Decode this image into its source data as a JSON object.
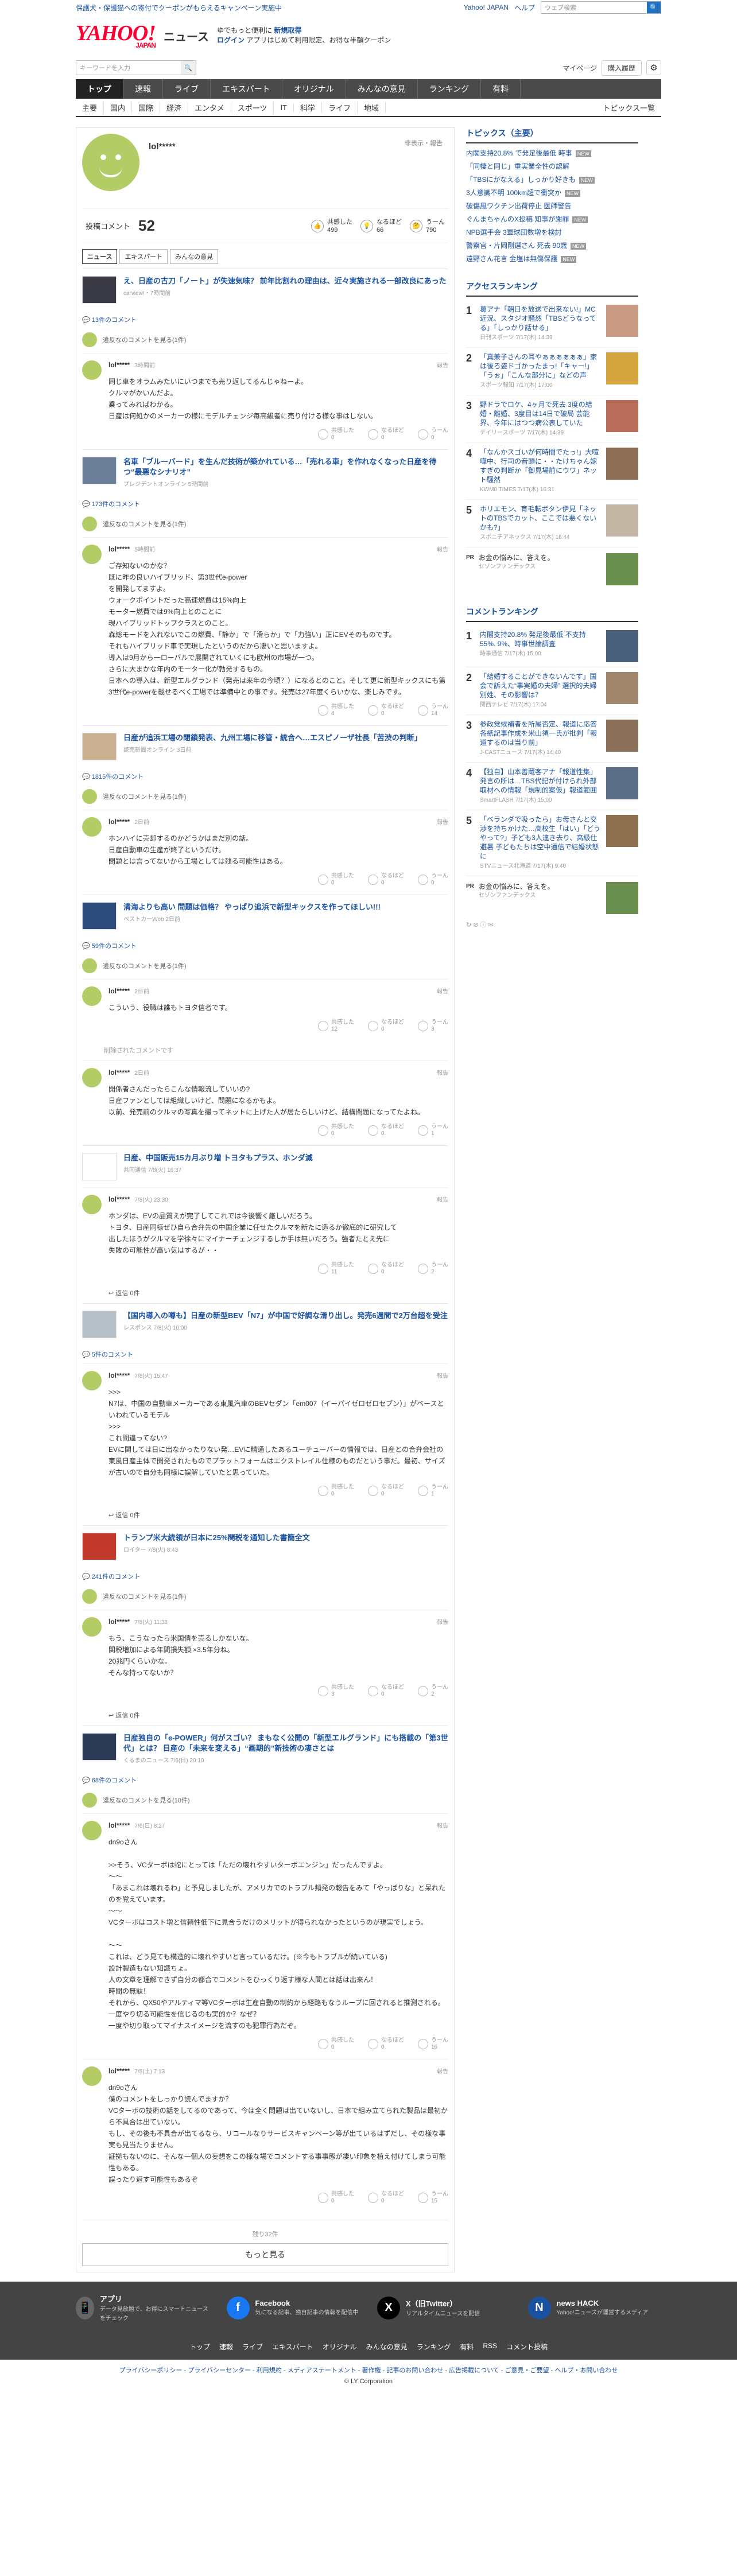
{
  "topbar": {
    "left": "保護犬・保護猫への寄付でクーポンがもらえるキャンペーン実施中",
    "links": [
      "Yahoo! JAPAN",
      "ヘルプ"
    ],
    "search_placeholder": "ウェブ検索",
    "search_btn": "🔍"
  },
  "header": {
    "logo": "YAHOO!",
    "logo_sub": "JAPAN",
    "service": "ニュース",
    "promo1": "ゆでもっと便利に",
    "promo1b": "新規取得",
    "promo2": "ログイン",
    "promo2b": "アプリはじめて利用限定、お得な半額クーポン"
  },
  "searchrow": {
    "placeholder": "キーワードを入力",
    "btn": "🔍",
    "mypage": "マイページ",
    "purchase": "購入履歴",
    "gear": "⚙"
  },
  "nav": [
    "トップ",
    "速報",
    "ライブ",
    "エキスパート",
    "オリジナル",
    "みんなの意見",
    "ランキング",
    "有料"
  ],
  "subnav": [
    "主要",
    "国内",
    "国際",
    "経済",
    "エンタメ",
    "スポーツ",
    "IT",
    "科学",
    "ライフ",
    "地域"
  ],
  "subnav_right": "トピックス一覧",
  "profile": {
    "name": "lol*****",
    "report": "非表示・報告",
    "label": "投稿コメント",
    "count": "52",
    "stats": [
      {
        "icon": "👍",
        "label": "共感した",
        "value": "499"
      },
      {
        "icon": "💡",
        "label": "なるほど",
        "value": "66"
      },
      {
        "icon": "🤔",
        "label": "うーん",
        "value": "790"
      }
    ]
  },
  "tabs": [
    "ニュース",
    "エキスパート",
    "みんなの意見"
  ],
  "vote_labels": [
    "共感した",
    "なるほど",
    "うーん"
  ],
  "reply_label": "返信",
  "reply_prompt": "違反なのコメントを見る(1件)",
  "deleted": "削除されたコメントです",
  "articles": [
    {
      "title": "え、日産の古刀「ノート」が失速気味？ 前年比割れの理由は、近々実施される一部改良にあった",
      "src": "carview!・7時間前",
      "count": "13件のコメント",
      "prompt": "違反なのコメントを見る(1件)",
      "color": "#3a3a44",
      "comments": [
        {
          "name": "lol*****",
          "time": "3時間前",
          "text": "同じ車をオラムみたいにいつまでも売り返してるんじゃねーよ。\nクルマがかいんだよ。\n乗ってみればわかる。\n日産は何処かのメーカーの様にモデルチェンジ毎高級者に売り付ける様な事はしない。",
          "votes": [
            "0",
            "0",
            "0"
          ]
        }
      ]
    },
    {
      "title": "名車「ブルーバード」を生んだ技術が築かれている…「売れる車」を作れなくなった日産を待つ“最悪なシナリオ”",
      "src": "プレジデントオンライン 5時間前",
      "count": "173件のコメント",
      "prompt": "違反なのコメントを見る(1件)",
      "color": "#6b7f99",
      "comments": [
        {
          "name": "lol*****",
          "time": "5時間前",
          "text": "ご存知ないのかな？\n既に昨の良いハイブリッド、第3世代e-power\nを開発してますよ。\nウォークポイントだった高速燃費は15%向上\nモーター燃費では9%向上とのことに\n現ハイブリッドトップクラスとのこと。\n森総モードを入れないでこの燃費、「静か」で「滑らか」で「力強い」正にEVそのものです。\nそれもハイブリッド車で実現したというのだから凄いと思いますよ。\n導入は9月から一ローバルで展開されていくにも欧州の市場が一つ。\nさらに大まかな年内のモーター化が勃発するもの。\n日本への導入は、新型エルグランド（発売は来年の今頃？）になるとのこと。そして更に新型キックスにも第3世代e-powerを載せるべく工場では準備中との事です。発売は27年度くらいかな、楽しみです。",
          "votes": [
            "4",
            "0",
            "14"
          ]
        }
      ]
    },
    {
      "title": "日産が追浜工場の閉鎖発表、九州工場に移管・統合へ…エスピノーザ社長「苦渋の判断」",
      "src": "読売新聞オンライン 3日前",
      "count": "1815件のコメント",
      "prompt": "違反なのコメントを見る(1件)",
      "color": "#c8b090",
      "comments": [
        {
          "name": "lol*****",
          "time": "2日前",
          "text": "ホンハイに売却するのかどうかはまだ別の話。\n日産自動車の生産が終了というだけ。\n問題とは言ってないから工場としては残る可能性はある。",
          "votes": [
            "0",
            "0",
            "0"
          ]
        }
      ]
    },
    {
      "title": "清海よりも高い 問題は価格？ やっぱり追浜で新型キックスを作ってほしい!!!",
      "src": "ベストカーWeb 2日前",
      "count": "59件のコメント",
      "prompt": "違反なのコメントを見る(1件)",
      "color": "#2c4a7a",
      "comments": [
        {
          "name": "lol*****",
          "time": "2日前",
          "text": "こういう、役職は誰もトヨタ信者です。",
          "votes": [
            "12",
            "0",
            "3"
          ]
        }
      ],
      "deleted": true,
      "comments2": [
        {
          "name": "lol*****",
          "time": "2日前",
          "text": "開係者さんだったらこんな情報流していいの?\n日産ファンとしては組織しいけど、問題になるかもよ。\n以前、発売前のクルマの写真を撮ってネットに上げた人が居たらしいけど、結構問題になってたよね。",
          "votes": [
            "0",
            "0",
            "1"
          ]
        }
      ]
    },
    {
      "title": "日産、中国販売15カ月ぶり増 トヨタもプラス、ホンダ減",
      "src": "共同通信 7/8(火) 16:37",
      "count": "",
      "color": "#ffffff",
      "comments": [
        {
          "name": "lol*****",
          "time": "7/8(火) 23:30",
          "text": "ホンダは、EVの品質えが完了してこれでは今後響く厳しいだろう。\nトヨタ、日産同様ぜひ自ら合弁先の中国企業に任せたクルマを新たに造るか徹底的に研究して\n出したほうがクルマを学徐々にマイナーチェンジするしか手は無いだろう。強者たとえ先に\n失敗の可能性が高い気はするが・・",
          "votes": [
            "11",
            "0",
            "2"
          ]
        }
      ],
      "reply": "返信 0件"
    },
    {
      "title": "【国内導入の噂も】日産の新型BEV「N7」が中国で好調な滑り出し。発売6週間で2万台超を受注",
      "src": "レスポンス 7/8(火) 10:00",
      "count": "5件のコメント",
      "color": "#b7bfc8",
      "comments": [
        {
          "name": "lol*****",
          "time": "7/8(火) 15:47",
          "text": ">>>\nN7は、中国の自動車メーカーである東風汽車のBEVセダン「em007（イーパイゼロゼロセブン）」がベースといわれているモデル\n>>>\nこれ間違ってない?\nEVに関しては日に出なかったりない発…EVに精通したあるユーチューバーの情報では、日産との合弁会社の東風日産主体で開発されたものでプラットフォームはエクストレイル仕様のものだという事だ。最初、サイズが古いので自分も同様に誤解していたと思っていた。",
          "votes": [
            "0",
            "0",
            "1"
          ]
        }
      ],
      "reply": "返信 0件"
    },
    {
      "title": "トランプ米大統領が日本に25%関税を通知した書簡全文",
      "src": "ロイター 7/8(火) 8:43",
      "count": "241件のコメント",
      "prompt": "違反なのコメントを見る(1件)",
      "color": "#c0392b",
      "comments": [
        {
          "name": "lol*****",
          "time": "7/8(火) 11:38",
          "text": "もう、こうなったら米国債を売るしかないな。\n関税増加による年間損失額 ×3.5年分ね。\n20兆円くらいかな。\nそんな持ってないか？",
          "votes": [
            "3",
            "0",
            "2"
          ]
        }
      ],
      "reply": "返信 0件"
    },
    {
      "title": "日産独自の「e-POWER」何がスゴい？ まもなく公開の「新型エルグランド」にも搭載の「第3世代」とは？ 日産の「未来を変える」“画期的”新技術の凄さとは",
      "src": "くるまのニュース 7/6(日) 20:10",
      "count": "68件のコメント",
      "prompt": "違反なのコメントを見る(10件)",
      "color": "#2b3a55",
      "comments": [
        {
          "name": "lol*****",
          "time": "7/6(日) 8:27",
          "text": "dn9oさん\n\n>>そう、VCターボは蛇にとっては「ただの壊れやすいターボエンジン」だったんですよ。\n〜〜\n「あまこれは壊れるわ」と予見しましたが、アメリカでのトラブル頻発の報告をみて「やっぱりな」と呆れたのを覚えています。\n〜〜\nVCターボはコスト増と信頼性低下に見合うだけのメリットが得られなかったというのが現実でしょう。\n\n〜〜\nこれは、どう見ても構造的に壊れやすいと言っているだけ。(※今もトラブルが続いている)\n設計製造もない知識ちょ。\n人の文章を理解できず自分の都合でコメントをひっくり返す様な人間とは話は出来ん！\n時間の無駄！\nそれから、QX50やアルティマ等VCターボは生産自動の制約から経路もなうループに回されると推測される。\n一度やり切る可能性を信じるのも実的か？なぜ？\n一度や切り取ってマイナスイメージを流すのも犯罪行為だぞ。",
          "votes": [
            "0",
            "0",
            "16"
          ]
        },
        {
          "name": "lol*****",
          "time": "7/5(土) 7:13",
          "text": "dn9oさん\n僕のコメントをしっかり読んでますか？\nVCターボの技術の話をしてるのであって、今は全く問題は出ていないし、日本で組み立てられた製品は最初から不具合は出ていない。\nもし、その後も不具合が出てるなら、リコールなりサービスキャンペーン等が出ているはずだし、その様な事実も見当たりません。\n証拠もないのに、そんな一個人の妄想をこの様な場でコメントする事事態が凄い印象を植え付けてしまう可能性もある。\n誤ったり返す可能性もあるぞ",
          "votes": [
            "0",
            "0",
            "15"
          ]
        }
      ]
    }
  ],
  "more": {
    "pager": "残り32件",
    "btn": "もっと見る"
  },
  "side": {
    "topics_title": "トピックス（主要）",
    "topics": [
      {
        "t": "内閣支持20.8% で発足後最低 時事",
        "n": true
      },
      {
        "t": "「同棲と同じ」重実業全性の認解",
        "n": false
      },
      {
        "t": "「TBSにかなえる」しっかり好きも",
        "n": true
      },
      {
        "t": "3人意識不明 100km超で衝突か",
        "n": true
      },
      {
        "t": "破傷風ワクチン出荷停止 医師警告",
        "n": false
      },
      {
        "t": "ぐんまちゃんのX投稿 知事が謝罪",
        "n": true
      },
      {
        "t": "NPB選手会 3軍球団数増を検討",
        "n": false
      },
      {
        "t": "警察官・片岡剛選さん 死去 90歳",
        "n": true
      },
      {
        "t": "遠野さん花言 金塩は無傷保護",
        "n": true
      }
    ],
    "access_title": "アクセスランキング",
    "access": [
      {
        "t": "葛アナ「朝日を放送で出来ない!」MC近況、スタジオ騒然「TBSどうなってる」「しっかり話せる」",
        "s": "日刊スポーツ 7/17(木) 14:39",
        "c": "#c99b84"
      },
      {
        "t": "「真兼子さんの耳やぁぁぁぁぁぁ」家は後ろ姿ドゴかったまっ!「キャー!」「うぉ」「こんな部分に」などの声",
        "s": "スポーツ報知 7/17(木) 17:00",
        "c": "#d4a53f"
      },
      {
        "t": "野ドラでロケ、4ヶ月で死去 3度の結婚・離婚、3度目は14日で破局 芸能界、今年にはつつ病公表していた",
        "s": "デイリースポーツ 7/17(木) 14:39",
        "c": "#b86d5b"
      },
      {
        "t": "「なんかスゴいが何時間でたっ!」大喧嘩中、行司の音頭に・・たけちゃん嫁すぎの判断か「御見場前にウワ」ネット騒然",
        "s": "KWM0 TIMES 7/17(木) 16:31",
        "c": "#8b6e55"
      },
      {
        "t": "ホリエモン、育毛転ボタン伊見「ネットのTBSでカット、ここでは悪くないかも?」",
        "s": "スポニチアネックス 7/17(木) 16:44",
        "c": "#c4b7a5"
      }
    ],
    "pr1": {
      "tag": "PR",
      "t": "お金の悩みに、答えを。",
      "s": "セゾンファンデックス",
      "c": "#6b8f4e"
    },
    "comment_title": "コメントランキング",
    "comment": [
      {
        "t": "内閣支持20.8% 発足後最低 不支持55%. 9%、時事世論調査",
        "s": "時事通信 7/17(木) 15:00",
        "c": "#4a5f7a"
      },
      {
        "t": "「結婚することができないんです」国会で訴えた“事実婚の夫婦” 選択的夫婦別姓、その影響は？",
        "s": "関西テレビ 7/17(木) 17:04",
        "c": "#a0866d"
      },
      {
        "t": "参政党候補者を所属否定、報道に応答各紙記事作成を米山領一氏が批判「報道するのは当り前」",
        "s": "J-CASTニュース 7/17(木) 14:40",
        "c": "#8a7058"
      },
      {
        "t": "【独自】山本善蔵客アナ「報道性集」発言の所は…TBS代記が付けられ外部取材への情報「規制的案仮」報道範囲",
        "s": "SmartFLASH 7/17(木) 15:00",
        "c": "#5c6f88"
      },
      {
        "t": "「ベランダで吸ったら」お母さんと交渉を持ちかけた…高校生「はい」「どうやって?」子ども3人違き去り、高級仕避暑 子どもたちは空中通信で結婚状態に",
        "s": "STVニュース北海道 7/17(木) 9:40",
        "c": "#8b6f4e"
      }
    ],
    "pr2": {
      "tag": "PR",
      "t": "お金の悩みに、答えを。",
      "s": "セゾンファンデックス",
      "c": "#6b8f4e"
    },
    "report": "↻ ⊘ ⓘ ✉"
  },
  "footer": {
    "boxes": [
      {
        "icon": "📱",
        "title": "アプリ",
        "desc": "データ見放題で、お得にスマートニュースをチェック",
        "color": "#666"
      },
      {
        "icon": "f",
        "title": "Facebook",
        "desc": "気になる記事、独自記事の情報を配信中",
        "color": "#1877f2"
      },
      {
        "icon": "X",
        "title": "X（旧Twitter）",
        "desc": "リアルタイムニュースを配信",
        "color": "#000"
      },
      {
        "icon": "N",
        "title": "news HACK",
        "desc": "Yahoo!ニュースが運営するメディア",
        "color": "#1a52a0"
      }
    ],
    "links": [
      "トップ",
      "速報",
      "ライブ",
      "エキスパート",
      "オリジナル",
      "みんなの意見",
      "ランキング",
      "有料",
      "RSS",
      "コメント投稿"
    ],
    "legal": "プライバシーポリシー - プライバシーセンター - 利用規約 - メディアステートメント - 著作権 - 記事のお問い合わせ - 広告掲載について - ご意見・ご要望 - ヘルプ・お問い合わせ",
    "copy": "© LY Corporation"
  }
}
